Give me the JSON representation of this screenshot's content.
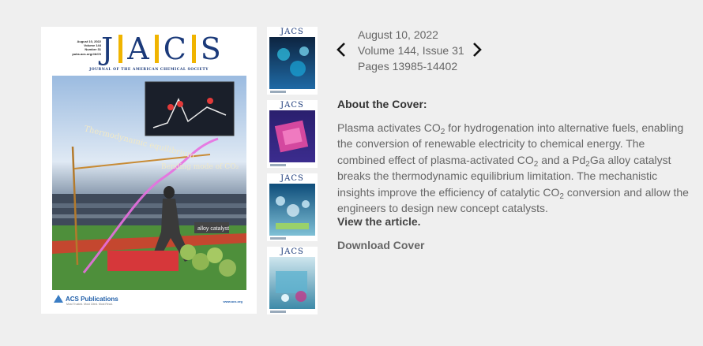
{
  "main_cover": {
    "journal_letters": [
      "J",
      "A",
      "C",
      "S"
    ],
    "journal_name": "JOURNAL OF THE AMERICAN CHEMICAL SOCIETY",
    "meta_lines": [
      "August 10, 2022",
      "Volume 144",
      "Number 31",
      "pubs.acs.org/JACS"
    ],
    "art_labels": [
      "Thermodynamic equilibrium",
      "Bending mode of CO₂",
      "alloy catalyst"
    ],
    "publisher": "ACS Publications",
    "publisher_tagline": "Most Trusted. Most Cited. Most Read.",
    "site": "www.acs.org"
  },
  "thumbnails": [
    {
      "title": "JACS",
      "color_top": "#0d2440",
      "color_bottom": "#1f6aa5"
    },
    {
      "title": "JACS",
      "color_top": "#2a1f6e",
      "color_bottom": "#c03a9e"
    },
    {
      "title": "JACS",
      "color_top": "#0e4d7a",
      "color_bottom": "#7fc0d6"
    },
    {
      "title": "JACS",
      "color_top": "#cfe6ee",
      "color_bottom": "#3d8aa8"
    }
  ],
  "issue": {
    "date": "August 10, 2022",
    "volume_issue": "Volume 144, Issue 31",
    "pages": "Pages 13985-14402"
  },
  "about": {
    "heading": "About the Cover:",
    "text_1": "Plasma activates CO",
    "text_2": " for hydrogenation into alternative fuels, enabling the conversion of renewable electricity to chemical energy. The combined effect of plasma-activated CO",
    "text_3": " and a Pd",
    "text_4": "Ga alloy catalyst breaks the thermodynamic equilibrium limitation. The mechanistic insights improve the efficiency of catalytic CO",
    "text_5": " conversion and allow the engineers to design new concept catalysts.",
    "sub": "2",
    "view_link": "View the article.",
    "download_link": "Download Cover"
  },
  "icons": {
    "prev": "chevron-left-icon",
    "next": "chevron-right-icon"
  },
  "colors": {
    "background": "#efefef",
    "jacs_blue": "#1b3a7a",
    "jacs_gold": "#f0b400"
  }
}
